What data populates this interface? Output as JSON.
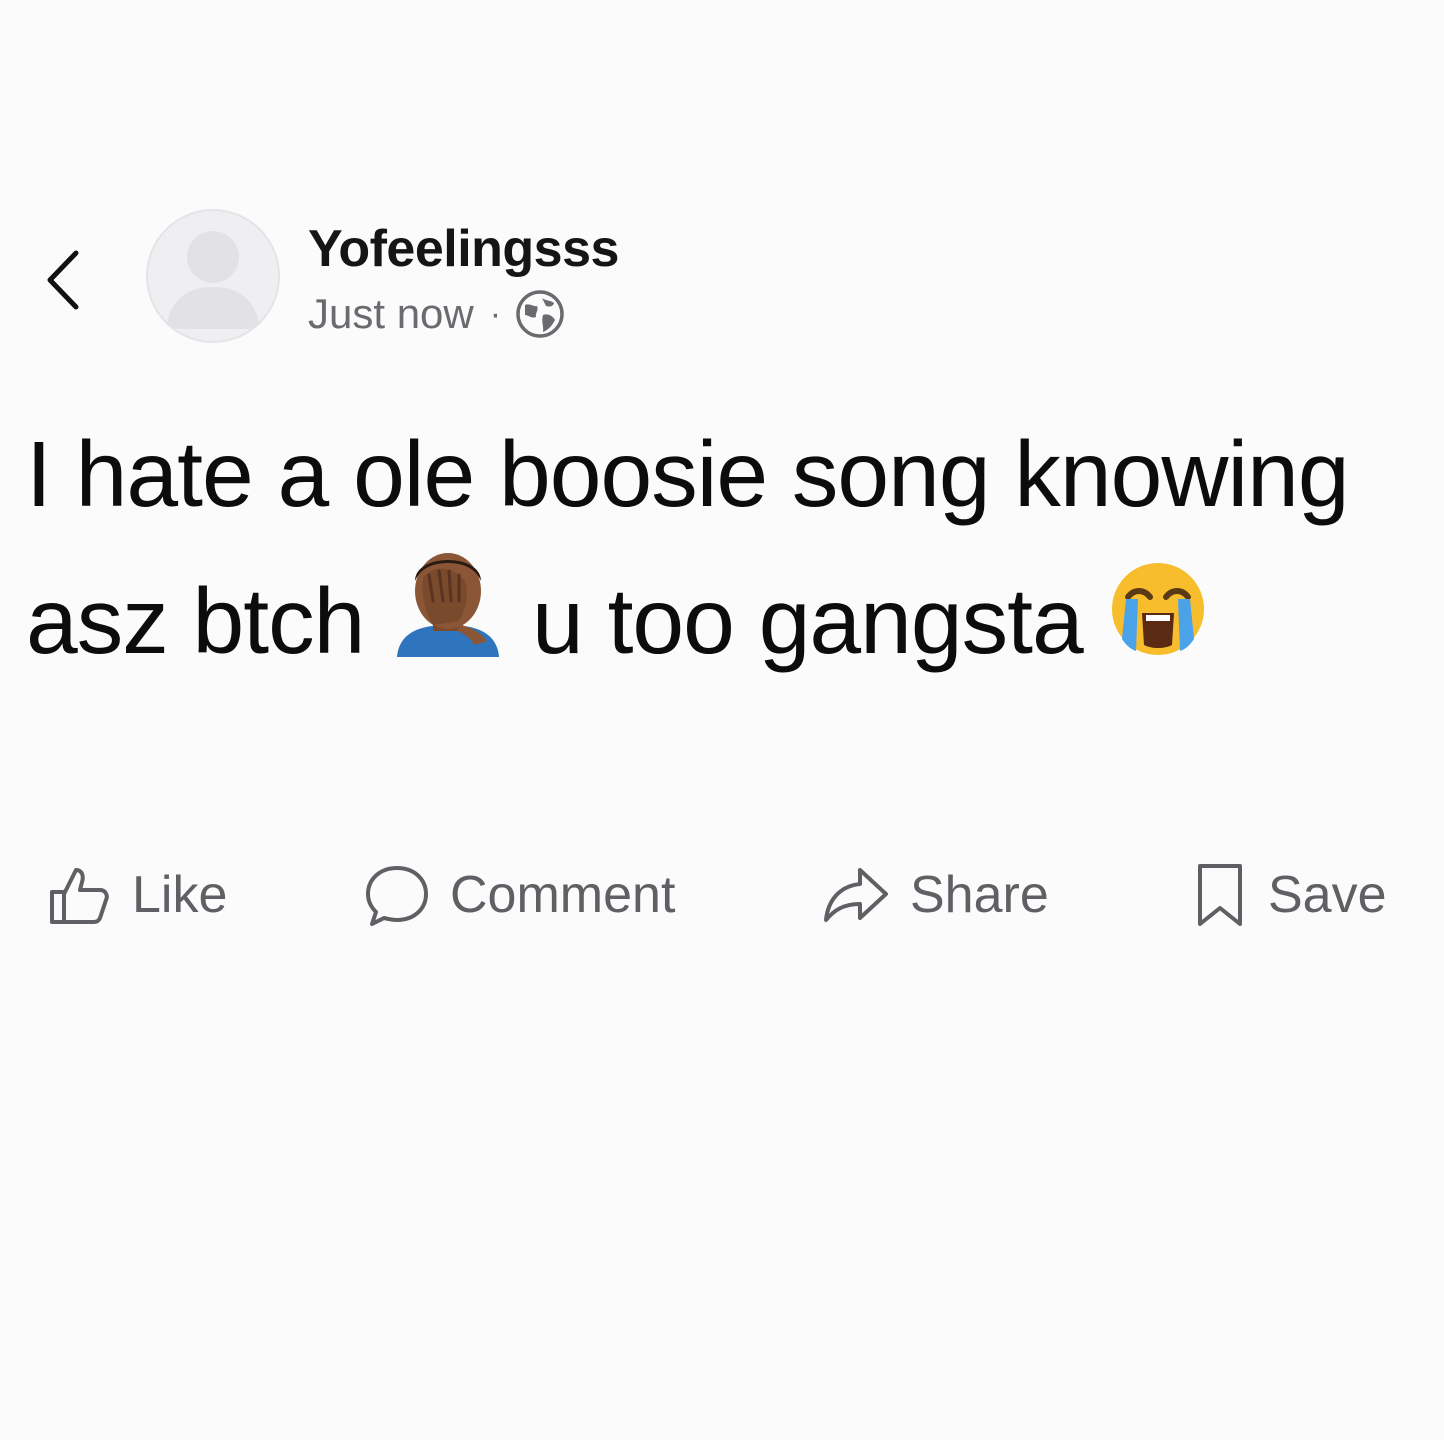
{
  "post": {
    "author": "Yofeelingsss",
    "timestamp": "Just now",
    "separator": "·",
    "visibility_icon": "globe-icon",
    "text_part1": "I hate a ole boosie song knowing asz btch",
    "emoji1": "man-facepalming-medium-dark-skin-tone",
    "text_part2": "u too gangsta",
    "emoji2": "loudly-crying-face"
  },
  "actions": {
    "like_label": "Like",
    "comment_label": "Comment",
    "share_label": "Share",
    "save_label": "Save"
  },
  "colors": {
    "background": "#fbfbfc",
    "text": "#0c0c0c",
    "muted": "#5f5f64"
  }
}
